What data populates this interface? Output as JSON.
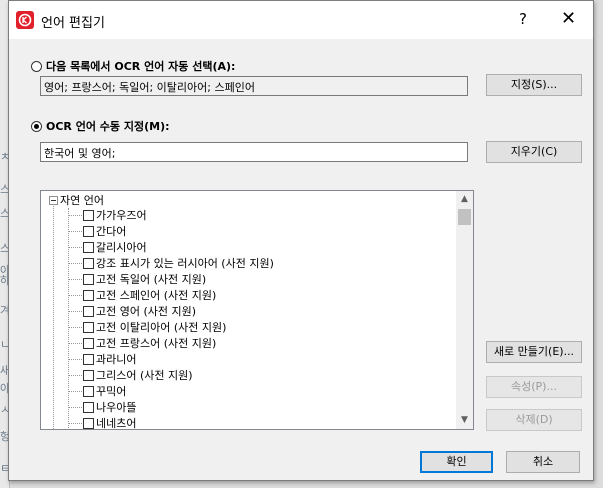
{
  "window": {
    "title": "언어 편집기",
    "help_label": "?",
    "close_label": "✕"
  },
  "auto": {
    "radio_label": "다음 목록에서 OCR 언어 자동 선택(A):",
    "value": "영어; 프랑스어; 독일어; 이탈리아어; 스페인어",
    "button": "지정(S)..."
  },
  "manual": {
    "radio_label": "OCR 언어 수동 지정(M):",
    "value": "한국어 및 영어;",
    "button": "지우기(C)"
  },
  "tree": {
    "root_label": "자연 언어",
    "items": [
      "가가우즈어",
      "간다어",
      "갈리시아어",
      "강조 표시가 있는 러시아어 (사전 지원)",
      "고전 독일어 (사전 지원)",
      "고전 스페인어 (사전 지원)",
      "고전 영어 (사전 지원)",
      "고전 이탈리아어 (사전 지원)",
      "고전 프랑스어 (사전 지원)",
      "과라니어",
      "그리스어 (사전 지원)",
      "꾸믹어",
      "나우아뜰",
      "네네츠어"
    ]
  },
  "side_buttons": {
    "new": "새로 만들기(E)...",
    "properties": "속성(P)...",
    "delete": "삭제(D)"
  },
  "footer": {
    "ok": "확인",
    "cancel": "취소"
  },
  "background_glyphs": [
    "ㅊ",
    "스",
    "스",
    "스",
    "아",
    "하",
    "겨",
    "ㄴ",
    "새",
    "아",
    "ㅅ",
    "헝",
    "ㅌ"
  ],
  "colors": {
    "app_icon": "#e0202a",
    "default_button_border": "#0078d7"
  }
}
